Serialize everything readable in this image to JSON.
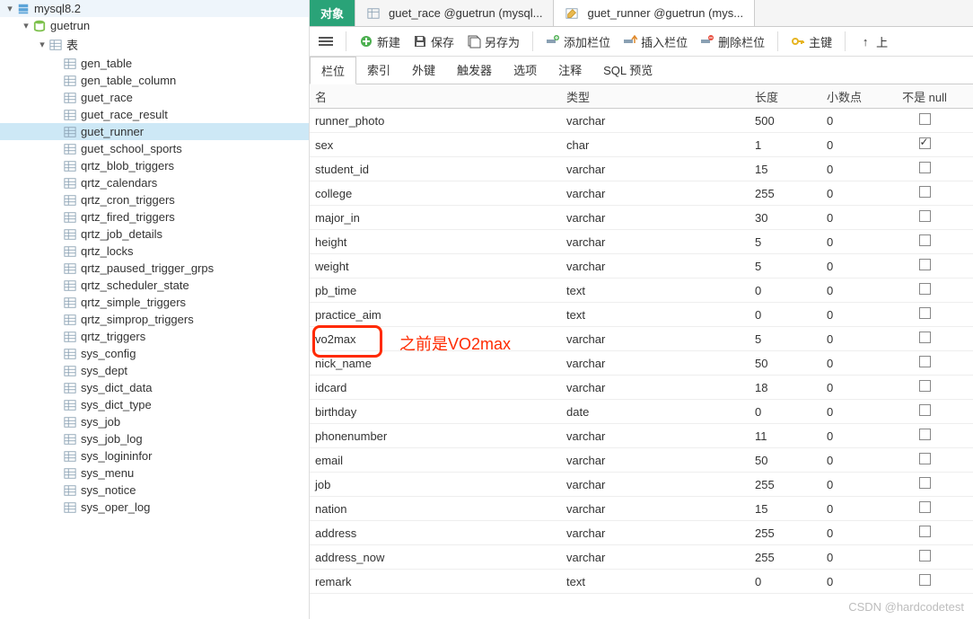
{
  "sidebar": {
    "connection": "mysql8.2",
    "database": "guetrun",
    "tables_label": "表",
    "tables": [
      "gen_table",
      "gen_table_column",
      "guet_race",
      "guet_race_result",
      "guet_runner",
      "guet_school_sports",
      "qrtz_blob_triggers",
      "qrtz_calendars",
      "qrtz_cron_triggers",
      "qrtz_fired_triggers",
      "qrtz_job_details",
      "qrtz_locks",
      "qrtz_paused_trigger_grps",
      "qrtz_scheduler_state",
      "qrtz_simple_triggers",
      "qrtz_simprop_triggers",
      "qrtz_triggers",
      "sys_config",
      "sys_dept",
      "sys_dict_data",
      "sys_dict_type",
      "sys_job",
      "sys_job_log",
      "sys_logininfor",
      "sys_menu",
      "sys_notice",
      "sys_oper_log"
    ],
    "selected": "guet_runner"
  },
  "tabs": {
    "object": "对象",
    "t1": "guet_race @guetrun (mysql...",
    "t2": "guet_runner @guetrun (mys..."
  },
  "toolbar": {
    "new": "新建",
    "save": "保存",
    "saveas": "另存为",
    "addfield": "添加栏位",
    "insertfield": "插入栏位",
    "deletefield": "删除栏位",
    "primarykey": "主键",
    "up": "上"
  },
  "subtabs": [
    "栏位",
    "索引",
    "外键",
    "触发器",
    "选项",
    "注释",
    "SQL 预览"
  ],
  "grid": {
    "headers": {
      "name": "名",
      "type": "类型",
      "len": "长度",
      "dec": "小数点",
      "notnull": "不是 null"
    },
    "rows": [
      {
        "name": "runner_photo",
        "type": "varchar",
        "len": "500",
        "dec": "0",
        "nn": false
      },
      {
        "name": "sex",
        "type": "char",
        "len": "1",
        "dec": "0",
        "nn": true
      },
      {
        "name": "student_id",
        "type": "varchar",
        "len": "15",
        "dec": "0",
        "nn": false
      },
      {
        "name": "college",
        "type": "varchar",
        "len": "255",
        "dec": "0",
        "nn": false
      },
      {
        "name": "major_in",
        "type": "varchar",
        "len": "30",
        "dec": "0",
        "nn": false
      },
      {
        "name": "height",
        "type": "varchar",
        "len": "5",
        "dec": "0",
        "nn": false
      },
      {
        "name": "weight",
        "type": "varchar",
        "len": "5",
        "dec": "0",
        "nn": false
      },
      {
        "name": "pb_time",
        "type": "text",
        "len": "0",
        "dec": "0",
        "nn": false
      },
      {
        "name": "practice_aim",
        "type": "text",
        "len": "0",
        "dec": "0",
        "nn": false
      },
      {
        "name": "vo2max",
        "type": "varchar",
        "len": "5",
        "dec": "0",
        "nn": false
      },
      {
        "name": "nick_name",
        "type": "varchar",
        "len": "50",
        "dec": "0",
        "nn": false
      },
      {
        "name": "idcard",
        "type": "varchar",
        "len": "18",
        "dec": "0",
        "nn": false
      },
      {
        "name": "birthday",
        "type": "date",
        "len": "0",
        "dec": "0",
        "nn": false
      },
      {
        "name": "phonenumber",
        "type": "varchar",
        "len": "11",
        "dec": "0",
        "nn": false
      },
      {
        "name": "email",
        "type": "varchar",
        "len": "50",
        "dec": "0",
        "nn": false
      },
      {
        "name": "job",
        "type": "varchar",
        "len": "255",
        "dec": "0",
        "nn": false
      },
      {
        "name": "nation",
        "type": "varchar",
        "len": "15",
        "dec": "0",
        "nn": false
      },
      {
        "name": "address",
        "type": "varchar",
        "len": "255",
        "dec": "0",
        "nn": false
      },
      {
        "name": "address_now",
        "type": "varchar",
        "len": "255",
        "dec": "0",
        "nn": false
      },
      {
        "name": "remark",
        "type": "text",
        "len": "0",
        "dec": "0",
        "nn": false
      }
    ]
  },
  "annotation": "之前是VO2max",
  "watermark": "CSDN @hardcodetest"
}
